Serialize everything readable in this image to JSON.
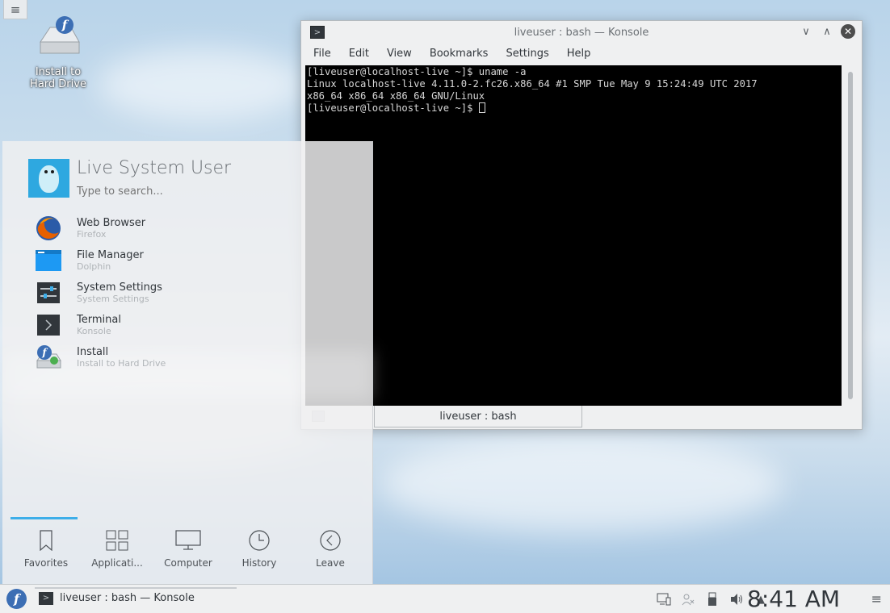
{
  "desktop": {
    "icon_label": "Install to\nHard Drive"
  },
  "konsole": {
    "title": "liveuser : bash — Konsole",
    "menu": [
      "File",
      "Edit",
      "View",
      "Bookmarks",
      "Settings",
      "Help"
    ],
    "terminal_lines": [
      "[liveuser@localhost-live ~]$ uname -a",
      "Linux localhost-live 4.11.0-2.fc26.x86_64 #1 SMP Tue May 9 15:24:49 UTC 2017",
      "x86_64 x86_64 x86_64 GNU/Linux",
      "[liveuser@localhost-live ~]$ "
    ],
    "tab_label": "liveuser : bash"
  },
  "launcher": {
    "username": "Live System User",
    "search_placeholder": "Type to search...",
    "favorites": [
      {
        "name": "Web Browser",
        "sub": "Firefox",
        "icon": "firefox-icon"
      },
      {
        "name": "File Manager",
        "sub": "Dolphin",
        "icon": "folder-icon"
      },
      {
        "name": "System Settings",
        "sub": "System Settings",
        "icon": "settings-icon"
      },
      {
        "name": "Terminal",
        "sub": "Konsole",
        "icon": "terminal-icon"
      },
      {
        "name": "Install",
        "sub": "Install to Hard Drive",
        "icon": "install-icon"
      }
    ],
    "tabs": [
      "Favorites",
      "Applicati...",
      "Computer",
      "History",
      "Leave"
    ]
  },
  "panel": {
    "task_label": "liveuser : bash — Konsole",
    "clock": "8:41 AM"
  },
  "colors": {
    "accent": "#3daee9",
    "panel_bg": "#eff0f1",
    "terminal_bg": "#000000"
  }
}
